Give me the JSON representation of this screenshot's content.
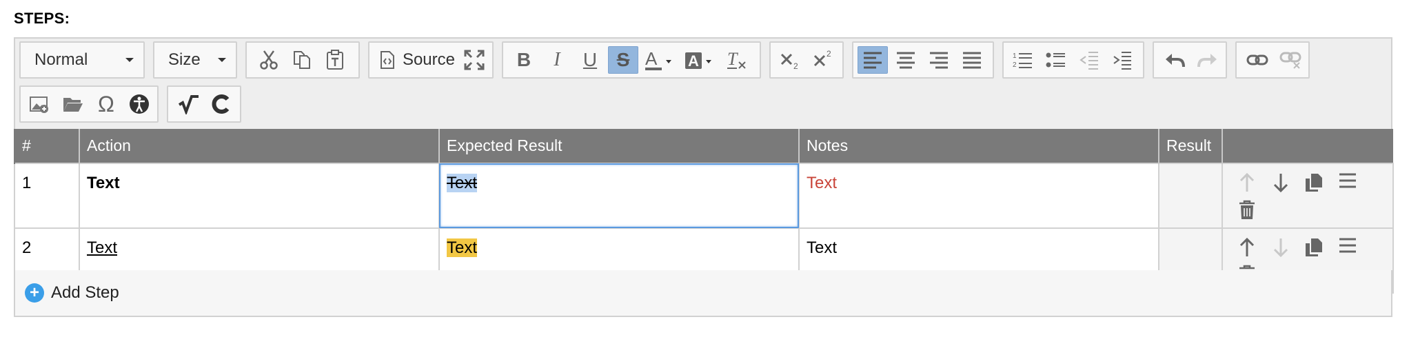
{
  "section": {
    "title": "STEPS:"
  },
  "toolbar": {
    "format_combo": "Normal",
    "size_combo": "Size",
    "source_label": "Source"
  },
  "table": {
    "headers": [
      "#",
      "Action",
      "Expected Result",
      "Notes",
      "Result",
      ""
    ],
    "rows": [
      {
        "num": "1",
        "action": "Text",
        "expected": "Text",
        "notes": "Text",
        "result": ""
      },
      {
        "num": "2",
        "action": "Text",
        "expected": "Text",
        "notes": "Text",
        "result": ""
      }
    ]
  },
  "footer": {
    "add_step_label": "Add Step",
    "add_icon_glyph": "+"
  },
  "colors": {
    "header_bg": "#7a7a7a",
    "toolbar_active": "#93b6dd",
    "notes_red": "#c9453a",
    "highlight_yellow": "#f2c744",
    "add_button_blue": "#3a9ee8",
    "editing_outline": "#5b9ae0"
  }
}
